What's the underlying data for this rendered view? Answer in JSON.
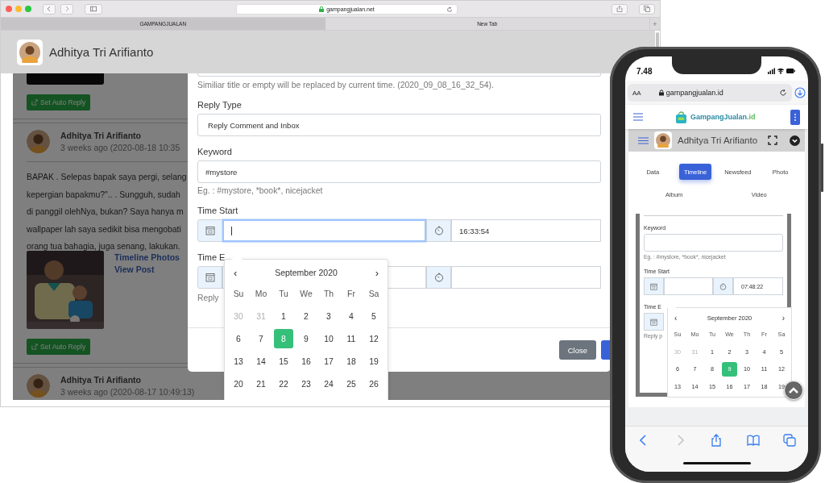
{
  "browser": {
    "address": "gampangjualan.net",
    "tabs": [
      {
        "label": "GAMPANGJUALAN",
        "selected": true
      },
      {
        "label": "New Tab",
        "selected": false
      }
    ],
    "new_tab_button": "+"
  },
  "page_header": {
    "user_name": "Adhitya Tri Arifianto"
  },
  "posts": [
    {
      "kind": "tail",
      "button": "Set Auto Reply"
    },
    {
      "kind": "full",
      "author": "Adhitya Tri Arifianto",
      "time": "3 weeks ago (2020-08-18 10:35",
      "text_lines": [
        "BAPAK . Selepas bapak saya pergi, selang",
        "kepergian bapakmu?\".. . Sungguh, sudah",
        "di panggil olehNya, bukan? Saya hanya m",
        "wallpaper lah saya sedikit bisa mengobati",
        "orang tua bahagia, juga senang, lakukan."
      ],
      "links": [
        "Timeline Photos",
        "View Post"
      ],
      "button": "Set Auto Reply"
    },
    {
      "kind": "head",
      "author": "Adhitya Tri Arifianto",
      "time": "3 weeks ago (2020-08-17 10:49:13)"
    }
  ],
  "modal": {
    "help_top": "Similiar title or empty will be replaced by current time. (2020_09_08_16_32_54).",
    "reply_type": {
      "label": "Reply Type",
      "value": "Reply Comment and Inbox"
    },
    "keyword": {
      "label": "Keyword",
      "value": "#mystore",
      "help": "Eg. : #mystore, *book*, nicejacket"
    },
    "time_start": {
      "label": "Time Start",
      "date_focused": true,
      "time_value": "16:33:54"
    },
    "time_end": {
      "label": "Time E"
    },
    "reply_help": "Reply",
    "buttons": [
      {
        "kind": "secondary",
        "label": "Close"
      },
      {
        "kind": "primary"
      }
    ]
  },
  "datepicker": {
    "prev": "‹",
    "month": "September 2020",
    "next": "›",
    "weekdays": [
      "Su",
      "Mo",
      "Tu",
      "We",
      "Th",
      "Fr",
      "Sa"
    ],
    "days": [
      {
        "label": "30",
        "muted": true,
        "selected": false
      },
      {
        "label": "31",
        "muted": true,
        "selected": false
      },
      {
        "label": "1",
        "muted": false,
        "selected": false
      },
      {
        "label": "2",
        "muted": false,
        "selected": false
      },
      {
        "label": "3",
        "muted": false,
        "selected": false
      },
      {
        "label": "4",
        "muted": false,
        "selected": false
      },
      {
        "label": "5",
        "muted": false,
        "selected": false
      },
      {
        "label": "6",
        "muted": false,
        "selected": false
      },
      {
        "label": "7",
        "muted": false,
        "selected": false
      },
      {
        "label": "8",
        "muted": false,
        "selected": true
      },
      {
        "label": "9",
        "muted": false,
        "selected": false
      },
      {
        "label": "10",
        "muted": false,
        "selected": false
      },
      {
        "label": "11",
        "muted": false,
        "selected": false
      },
      {
        "label": "12",
        "muted": false,
        "selected": false
      },
      {
        "label": "13",
        "muted": false,
        "selected": false
      },
      {
        "label": "14",
        "muted": false,
        "selected": false
      },
      {
        "label": "15",
        "muted": false,
        "selected": false
      },
      {
        "label": "16",
        "muted": false,
        "selected": false
      },
      {
        "label": "17",
        "muted": false,
        "selected": false
      },
      {
        "label": "18",
        "muted": false,
        "selected": false
      },
      {
        "label": "19",
        "muted": false,
        "selected": false
      },
      {
        "label": "20",
        "muted": false,
        "selected": false
      },
      {
        "label": "21",
        "muted": false,
        "selected": false
      },
      {
        "label": "22",
        "muted": false,
        "selected": false
      },
      {
        "label": "23",
        "muted": false,
        "selected": false
      },
      {
        "label": "24",
        "muted": false,
        "selected": false
      },
      {
        "label": "25",
        "muted": false,
        "selected": false
      },
      {
        "label": "26",
        "muted": false,
        "selected": false
      }
    ]
  },
  "phone": {
    "time": "7.48",
    "url_bar": {
      "text_size": "AA",
      "address": "gampangjualan.id"
    },
    "brand": {
      "name": "GampangJualan",
      "suffix": ".id"
    },
    "user_name": "Adhitya Tri Arifianto",
    "tabs": [
      {
        "label": "Data",
        "selected": false
      },
      {
        "label": "Timeline",
        "selected": true
      },
      {
        "label": "Newsfeed",
        "selected": false
      },
      {
        "label": "Photo",
        "selected": false
      },
      {
        "label": "Album",
        "selected": false
      },
      {
        "label": "Video",
        "selected": false
      }
    ],
    "keyword": {
      "label": "Keyword",
      "help": "Eg. : #mystore, *book*, nicejacket"
    },
    "time_start": {
      "label": "Time Start",
      "time_value": "07:48:22"
    },
    "time_end": {
      "label": "Time E"
    },
    "reply_help": "Reply p",
    "datepicker": {
      "prev": "‹",
      "month": "September 2020",
      "next": "›",
      "weekdays": [
        "Su",
        "Mo",
        "Tu",
        "We",
        "Th",
        "Fr",
        "Sa"
      ],
      "days": [
        {
          "label": "30",
          "muted": true,
          "selected": false
        },
        {
          "label": "31",
          "muted": true,
          "selected": false
        },
        {
          "label": "1",
          "muted": false,
          "selected": false
        },
        {
          "label": "2",
          "muted": false,
          "selected": false
        },
        {
          "label": "3",
          "muted": false,
          "selected": false
        },
        {
          "label": "4",
          "muted": false,
          "selected": false
        },
        {
          "label": "5",
          "muted": false,
          "selected": false
        },
        {
          "label": "6",
          "muted": false,
          "selected": false
        },
        {
          "label": "7",
          "muted": false,
          "selected": false
        },
        {
          "label": "8",
          "muted": false,
          "selected": false
        },
        {
          "label": "9",
          "muted": false,
          "selected": true
        },
        {
          "label": "10",
          "muted": false,
          "selected": false
        },
        {
          "label": "11",
          "muted": false,
          "selected": false
        },
        {
          "label": "12",
          "muted": false,
          "selected": false
        },
        {
          "label": "13",
          "muted": false,
          "selected": false
        },
        {
          "label": "14",
          "muted": false,
          "selected": false
        },
        {
          "label": "15",
          "muted": false,
          "selected": false
        },
        {
          "label": "16",
          "muted": false,
          "selected": false
        },
        {
          "label": "17",
          "muted": false,
          "selected": false
        },
        {
          "label": "18",
          "muted": false,
          "selected": false
        },
        {
          "label": "19",
          "muted": false,
          "selected": false
        }
      ]
    },
    "toolbar": [
      {
        "kind": "back",
        "disabled": false
      },
      {
        "kind": "forward",
        "disabled": true
      },
      {
        "kind": "share",
        "disabled": false
      },
      {
        "kind": "bookmarks",
        "disabled": false
      },
      {
        "kind": "tabs",
        "disabled": false
      }
    ]
  }
}
